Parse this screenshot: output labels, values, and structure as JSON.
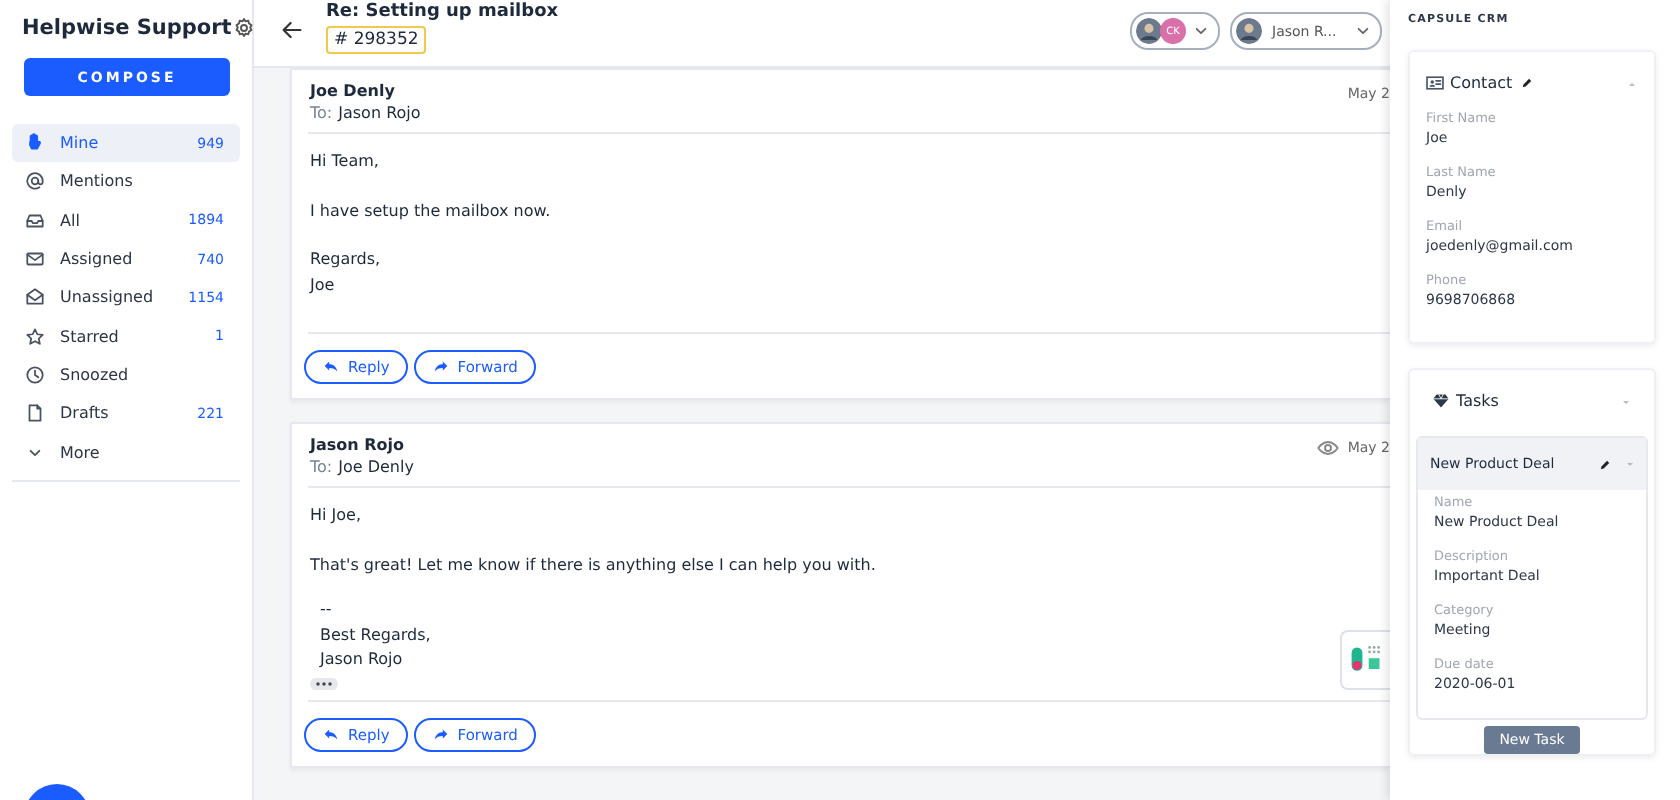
{
  "sidebar": {
    "title": "Helpwise Support",
    "compose": "COMPOSE",
    "items": [
      {
        "label": "Mine",
        "count": "949",
        "selected": true
      },
      {
        "label": "Mentions",
        "selected": false
      },
      {
        "label": "All",
        "count": "1894",
        "selected": false
      },
      {
        "label": "Assigned",
        "count": "740",
        "selected": false
      },
      {
        "label": "Unassigned",
        "count": "1154",
        "selected": false
      },
      {
        "label": "Starred",
        "count": "1",
        "selected": false
      },
      {
        "label": "Snoozed",
        "selected": false
      },
      {
        "label": "Drafts",
        "count": "221",
        "selected": false
      },
      {
        "label": "More",
        "selected": false
      }
    ]
  },
  "conversation": {
    "subject": "Re: Setting up mailbox",
    "ticket": "# 298352",
    "assignee_badge": "CK",
    "assignee": "Jason R...",
    "messages": [
      {
        "from": "Joe Denly",
        "to_label": "To:",
        "to": "Jason Rojo",
        "date": "May 2",
        "seen": false,
        "body": [
          [
            "Hi Team,"
          ],
          [
            "I have setup the mailbox now."
          ],
          [
            "Regards,",
            "Joe"
          ]
        ],
        "actions": [
          "Reply",
          "Forward"
        ]
      },
      {
        "from": "Jason Rojo",
        "to_label": "To:",
        "to": "Joe Denly",
        "date": "May 2",
        "seen": true,
        "body": [
          [
            "Hi Joe,"
          ],
          [
            "That's great! Let me know if there is anything else I can help you with."
          ]
        ],
        "signature": [
          "--",
          "Best Regards,",
          "Jason Rojo"
        ],
        "actions": [
          "Reply",
          "Forward"
        ]
      }
    ]
  },
  "crm": {
    "title": "CAPSULE CRM",
    "contact": {
      "title": "Contact",
      "fields": [
        {
          "label": "First Name",
          "value": "Joe"
        },
        {
          "label": "Last Name",
          "value": "Denly"
        },
        {
          "label": "Email",
          "value": "joedenly@gmail.com"
        },
        {
          "label": "Phone",
          "value": "9698706868"
        }
      ]
    },
    "tasks": {
      "title": "Tasks",
      "items": [
        {
          "title": "New Product Deal",
          "fields": [
            {
              "label": "Name",
              "value": "New Product Deal"
            },
            {
              "label": "Description",
              "value": "Important Deal"
            },
            {
              "label": "Category",
              "value": "Meeting"
            },
            {
              "label": "Due date",
              "value": "2020-06-01"
            }
          ]
        }
      ],
      "button": "New Task"
    }
  }
}
